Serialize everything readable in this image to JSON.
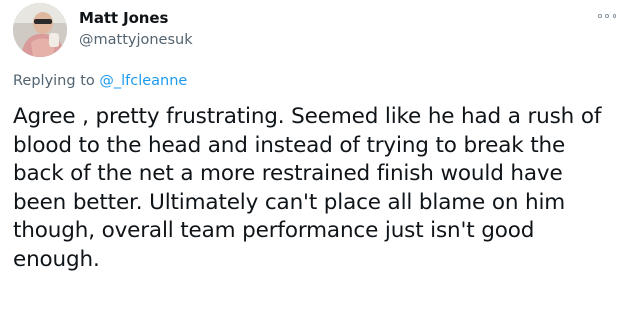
{
  "author": {
    "display_name": "Matt Jones",
    "handle": "@mattyjonesuk",
    "avatar_icon": "profile-photo"
  },
  "reply": {
    "prefix": "Replying to ",
    "mention": "@_lfcleanne"
  },
  "menu": {
    "icon": "more-options-icon"
  },
  "tweet": {
    "lines": [
      "Agree , pretty frustrating. Seemed like he had a rush of",
      "blood to the head and instead of trying to break the",
      "back of the net a more restrained finish would have",
      "been better. Ultimately can't place all blame on him",
      "though, overall team performance just isn't good",
      "enough."
    ]
  },
  "colors": {
    "text_primary": "#0f1419",
    "text_secondary": "#536471",
    "link": "#1d9bf0"
  }
}
